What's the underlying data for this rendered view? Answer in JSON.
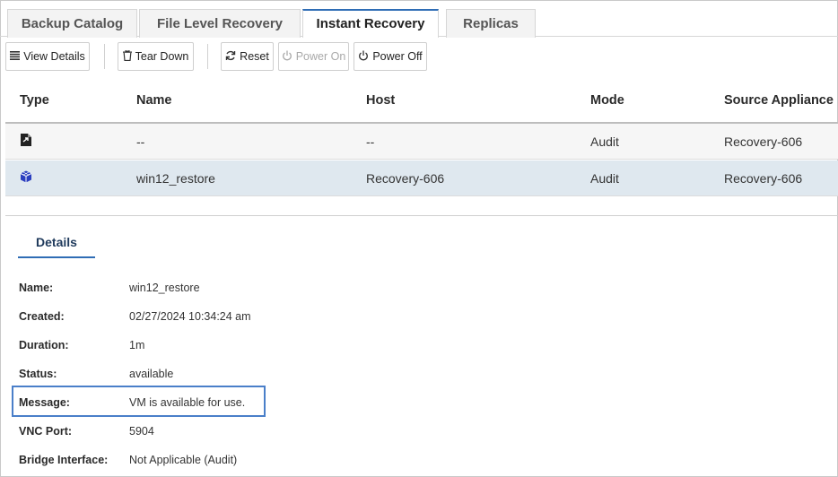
{
  "tabs": [
    {
      "label": "Backup Catalog"
    },
    {
      "label": "File Level Recovery"
    },
    {
      "label": "Instant Recovery"
    },
    {
      "label": "Replicas"
    }
  ],
  "toolbar": {
    "view_details": "View Details",
    "tear_down": "Tear Down",
    "reset": "Reset",
    "power_on": "Power On",
    "power_off": "Power Off"
  },
  "table": {
    "columns": [
      "Type",
      "Name",
      "Host",
      "Mode",
      "Source Appliance"
    ],
    "rows": [
      {
        "type_icon": "file-export-icon",
        "name": "--",
        "host": "--",
        "mode": "Audit",
        "source": "Recovery-606"
      },
      {
        "type_icon": "cube-icon",
        "name": "win12_restore",
        "host": "Recovery-606",
        "mode": "Audit",
        "source": "Recovery-606"
      }
    ]
  },
  "details": {
    "tab_label": "Details",
    "fields": [
      {
        "label": "Name:",
        "value": "win12_restore"
      },
      {
        "label": "Created:",
        "value": "02/27/2024 10:34:24 am"
      },
      {
        "label": "Duration:",
        "value": "1m"
      },
      {
        "label": "Status:",
        "value": "available"
      },
      {
        "label": "Message:",
        "value": "VM is available for use."
      },
      {
        "label": "VNC Port:",
        "value": "5904"
      },
      {
        "label": "Bridge Interface:",
        "value": "Not Applicable (Audit)"
      }
    ]
  },
  "colors": {
    "accent": "#2f6db5",
    "selected_row": "#dfe8ef",
    "highlight_box": "#4a7fc9"
  }
}
